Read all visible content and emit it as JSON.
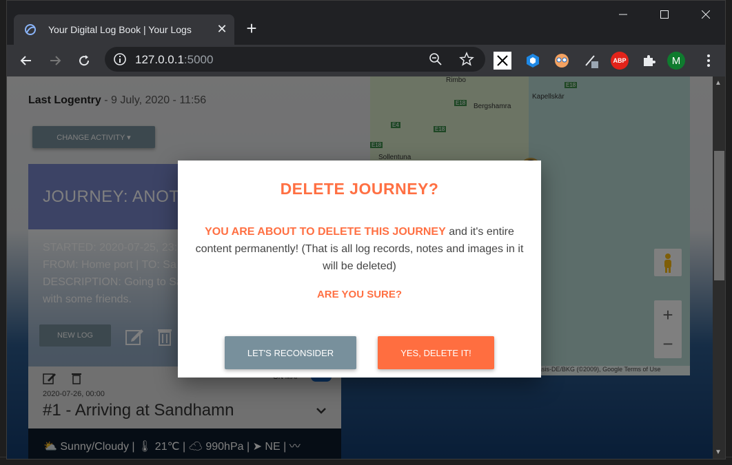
{
  "tab": {
    "title": "Your Digital Log Book | Your Logs",
    "close": "✕",
    "new_tab": "+"
  },
  "window": {
    "minimize": "—",
    "maximize": "☐",
    "close": "✕"
  },
  "omnibox": {
    "host": "127.0.0.1",
    "port": ":5000"
  },
  "extensions": {
    "abp": "ABP",
    "avatar": "M"
  },
  "page": {
    "last_log_label": "Last Logentry",
    "last_log_value": " - 9 July, 2020 - 11:56",
    "change_activity": "CHANGE ACTIVITY ▾",
    "journey_title": "JOURNEY: ANOTH",
    "journey_started": "STARTED: 2020-07-25, 23:",
    "journey_from_to": "FROM: Home port | TO: Sa",
    "journey_description": "DESCRIPTION: Going to Sa",
    "journey_description_2": "with some friends.",
    "new_log": "NEW LOG",
    "on_map": "ON MAP",
    "log_date": "2020-07-26, 00:00",
    "log_title": "#1 - Arriving at Sandhamn",
    "weather": "⛅ Sunny/Cloudy | 🌡 21℃ | ☁ 990hPa | ➤ NE | 〰"
  },
  "map": {
    "labels": {
      "rimbo": "Rimbo",
      "kapellskar": "Kapellskär",
      "bergshamra": "Bergshamra",
      "sollentuna": "Sollentuna"
    },
    "roads": {
      "e18a": "E18",
      "e18b": "E18",
      "e18c": "E18",
      "e4": "E4",
      "e18d": "E18"
    },
    "zoom_in": "+",
    "zoom_out": "−",
    "footer": "asis-DE/BKG (©2009), Google    Terms of Use"
  },
  "modal": {
    "title": "DELETE JOURNEY?",
    "warning": "YOU ARE ABOUT TO DELETE THIS JOURNEY",
    "text": " and it's entire content permanently! (That is all log records, notes and images in it will be deleted)",
    "confirm_question": "ARE YOU SURE?",
    "reconsider_button": "LET'S RECONSIDER",
    "delete_button": "YES, DELETE IT!"
  },
  "colors": {
    "accent": "#ff7043",
    "secondary_button": "#78909c",
    "journey_header": "#7986cb"
  }
}
